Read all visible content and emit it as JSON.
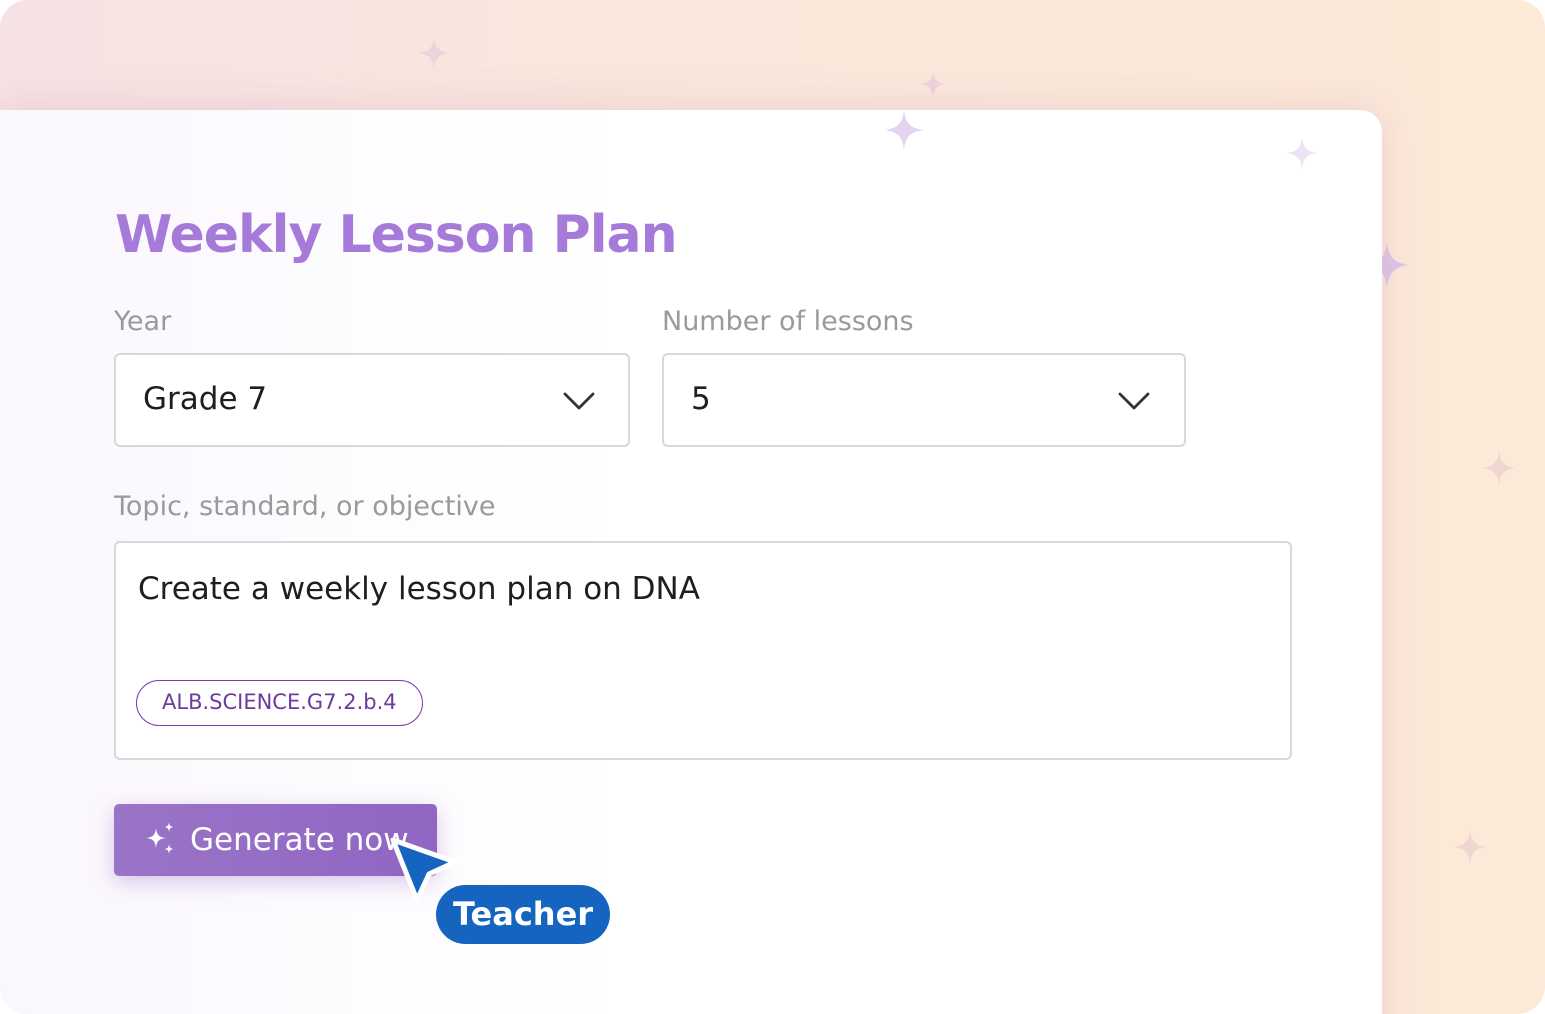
{
  "form": {
    "title": "Weekly Lesson Plan",
    "year": {
      "label": "Year",
      "value": "Grade 7"
    },
    "lessons": {
      "label": "Number of lessons",
      "value": "5"
    },
    "topic": {
      "label": "Topic, standard, or objective",
      "value": "Create a weekly lesson plan on DNA",
      "standard_chip": "ALB.SCIENCE.G7.2.b.4"
    },
    "generate_button": {
      "label": "Generate now",
      "icon": "sparkles-icon"
    }
  },
  "cursor": {
    "label": "Teacher",
    "icon": "mouse-pointer-icon"
  },
  "colors": {
    "title": "#a57ad9",
    "button": "#9a74c8",
    "chip_text": "#6d3a9f",
    "cursor": "#1565c0",
    "sparkle": "#d9c5ea"
  }
}
